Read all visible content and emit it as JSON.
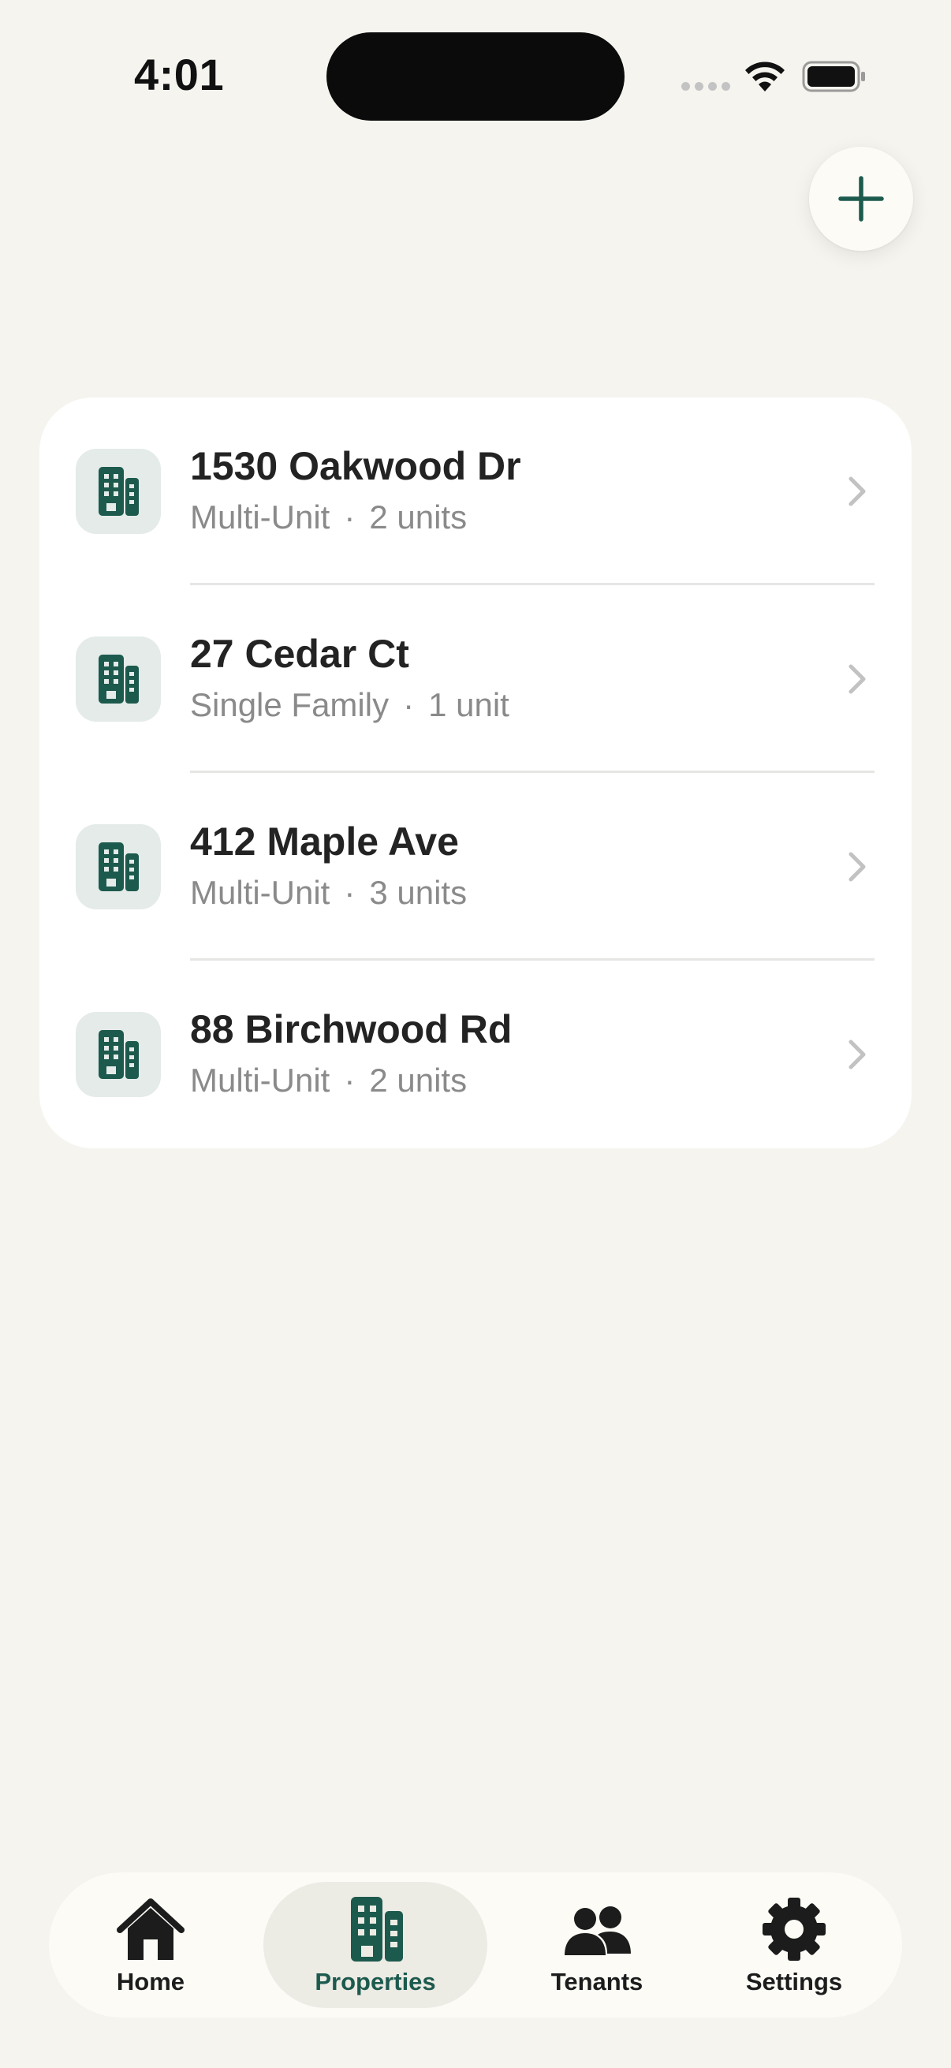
{
  "status_bar": {
    "time": "4:01"
  },
  "actions": {
    "add_icon": "plus-icon"
  },
  "properties": [
    {
      "name": "1530 Oakwood Dr",
      "type": "Multi-Unit",
      "separator": "·",
      "units": "2 units",
      "icon": "building-icon"
    },
    {
      "name": "27 Cedar Ct",
      "type": "Single Family",
      "separator": "·",
      "units": "1 unit",
      "icon": "building-icon"
    },
    {
      "name": "412 Maple Ave",
      "type": "Multi-Unit",
      "separator": "·",
      "units": "3 units",
      "icon": "building-icon"
    },
    {
      "name": "88 Birchwood Rd",
      "type": "Multi-Unit",
      "separator": "·",
      "units": "2 units",
      "icon": "building-icon"
    }
  ],
  "tab_bar": {
    "tabs": [
      {
        "label": "Home",
        "icon": "home-icon",
        "active": false
      },
      {
        "label": "Properties",
        "icon": "building-icon",
        "active": true
      },
      {
        "label": "Tenants",
        "icon": "people-icon",
        "active": false
      },
      {
        "label": "Settings",
        "icon": "gear-icon",
        "active": false
      }
    ]
  },
  "colors": {
    "background": "#f5f4ef",
    "card": "#ffffff",
    "accent": "#1d5a4e",
    "icon_tile": "#e4ebe8",
    "secondary_text": "#8a8a8a",
    "active_tab_bg": "#ecebe4"
  }
}
